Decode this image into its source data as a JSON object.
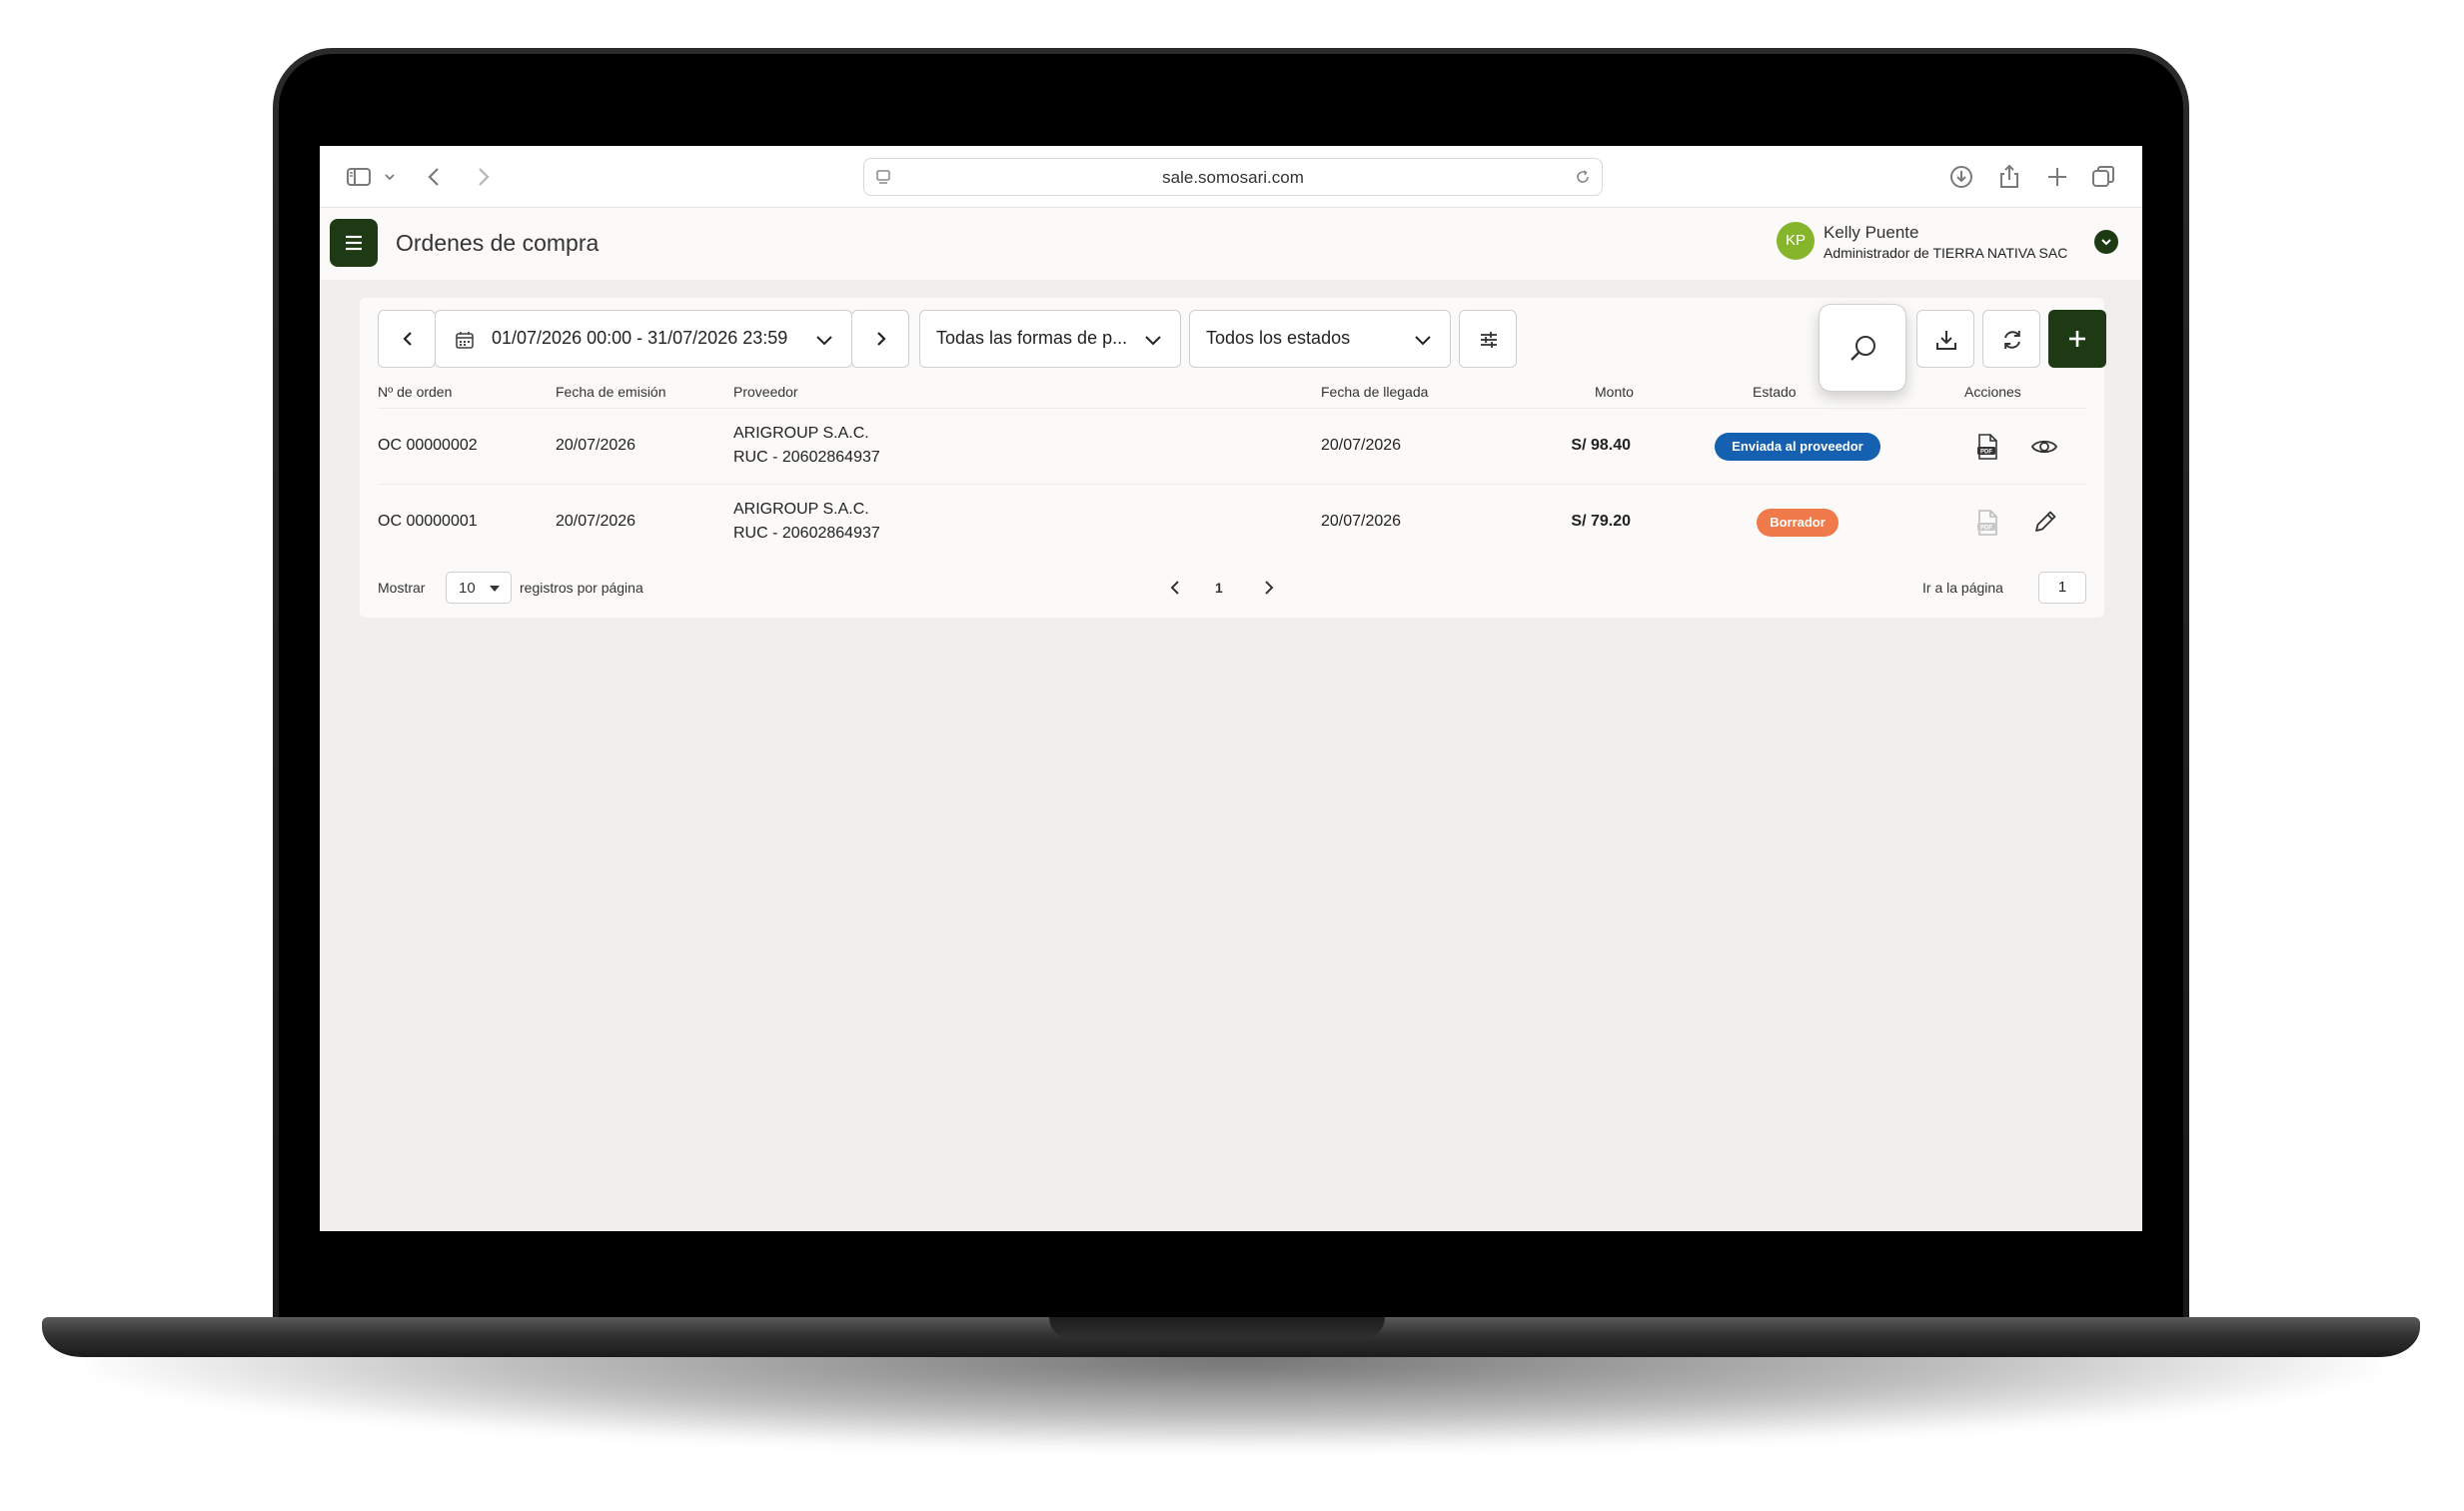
{
  "browser": {
    "url": "sale.somosari.com"
  },
  "header": {
    "title": "Ordenes de compra",
    "user": {
      "initials": "KP",
      "name": "Kelly Puente",
      "role": "Administrador de TIERRA NATIVA SAC"
    }
  },
  "filters": {
    "date_range": "01/07/2026 00:00 - 31/07/2026 23:59",
    "payment_method": "Todas las formas de p...",
    "status": "Todos los estados"
  },
  "table": {
    "columns": [
      "Nº de orden",
      "Fecha de emisión",
      "Proveedor",
      "Fecha de llegada",
      "Monto",
      "Estado",
      "Acciones"
    ],
    "rows": [
      {
        "order": "OC 00000002",
        "issue_date": "20/07/2026",
        "supplier": "ARIGROUP S.A.C.",
        "ruc": "RUC - 20602864937",
        "arrival_date": "20/07/2026",
        "amount": "S/ 98.40",
        "status": "Enviada al proveedor",
        "status_color": "#1560b0"
      },
      {
        "order": "OC 00000001",
        "issue_date": "20/07/2026",
        "supplier": "ARIGROUP S.A.C.",
        "ruc": "RUC - 20602864937",
        "arrival_date": "20/07/2026",
        "amount": "S/ 79.20",
        "status": "Borrador",
        "status_color": "#f07a4a"
      }
    ]
  },
  "pagination": {
    "show_label": "Mostrar",
    "per_page": "10",
    "per_page_suffix": "registros por página",
    "current_page": "1",
    "goto_label": "Ir a la página",
    "goto_value": "1"
  },
  "colors": {
    "accent": "#1d3a14",
    "avatar": "#86b52c",
    "background": "#f1efec"
  },
  "icons": [
    "sidebar-icon",
    "chevron-down-icon",
    "back-icon",
    "forward-icon",
    "download-icon",
    "share-icon",
    "plus-icon",
    "tabs-icon",
    "reload-icon",
    "menu-icon",
    "calendar-icon",
    "sliders-icon",
    "search-icon",
    "sync-icon",
    "pdf-icon",
    "eye-icon",
    "pencil-icon"
  ]
}
